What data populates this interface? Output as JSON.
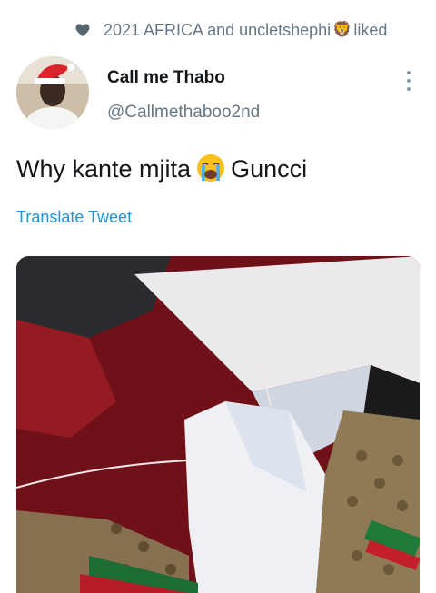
{
  "social_context": {
    "text_start": "2021 AFRICA and uncletshephi",
    "emoji": "🦁",
    "text_end": " liked",
    "icon": "heart-icon"
  },
  "tweet": {
    "display_name": "Call me Thabo",
    "display_name_suffix": "",
    "handle": "@Callmethaboo2nd",
    "text_part1": "Why kante mjita",
    "emoji": "crying-face",
    "text_part2": "Guncci",
    "translate_label": "Translate Tweet"
  },
  "icons": {
    "more": "more-vertical-icon"
  },
  "colors": {
    "secondary_text": "#657786",
    "link": "#1b95e0",
    "primary_text": "#14171a"
  }
}
